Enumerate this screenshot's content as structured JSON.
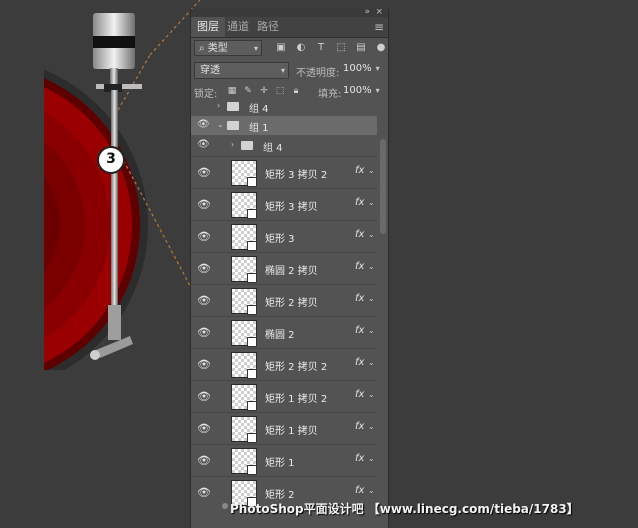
{
  "panel": {
    "tabs": [
      "图层",
      "通道",
      "路径"
    ],
    "filter_label": "类型",
    "blend_mode": "穿透",
    "opacity_label": "不透明度:",
    "opacity_value": "100%",
    "lock_label": "锁定:",
    "fill_label": "填充:",
    "fill_value": "100%"
  },
  "groups": [
    {
      "name": "组 4"
    },
    {
      "name": "组 1"
    },
    {
      "name": "组 4"
    }
  ],
  "layers": [
    {
      "name": "矩形 3 拷贝 2"
    },
    {
      "name": "矩形 3 拷贝"
    },
    {
      "name": "矩形 3"
    },
    {
      "name": "椭圆 2 拷贝"
    },
    {
      "name": "矩形 2 拷贝"
    },
    {
      "name": "椭圆 2"
    },
    {
      "name": "矩形 2 拷贝 2"
    },
    {
      "name": "矩形 1 拷贝 2"
    },
    {
      "name": "矩形 1 拷贝"
    },
    {
      "name": "矩形 1"
    },
    {
      "name": "矩形 2"
    }
  ],
  "fx_label": "fx",
  "annotation_number": "3",
  "watermark": "PhotoShop平面设计吧 【www.linecg.com/tieba/1783】",
  "colors": {
    "background": "#3c3c3c",
    "panel": "#535353",
    "record_red": "#9a0000",
    "dash_line": "#b07a3c"
  }
}
